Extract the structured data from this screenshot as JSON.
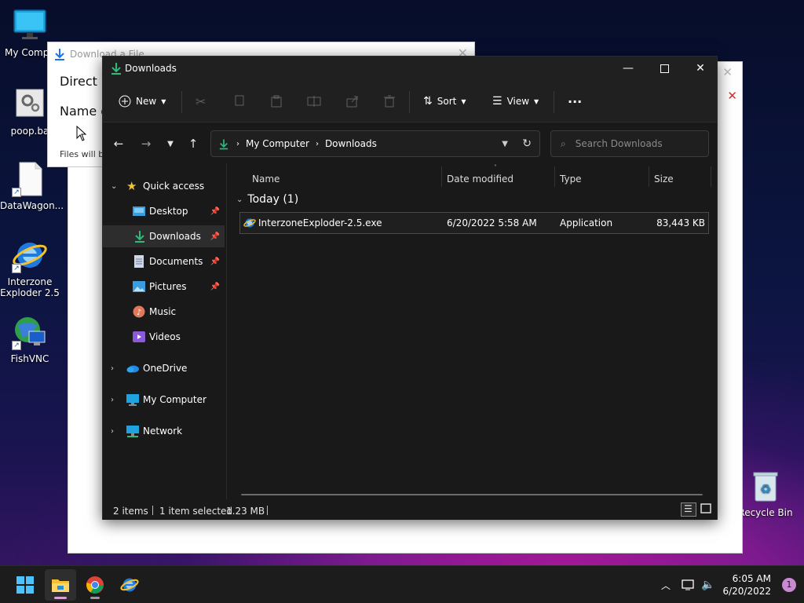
{
  "desktop": {
    "icons": [
      {
        "label": "My Compu",
        "icon": "monitor-icon"
      },
      {
        "label": "poop.ba",
        "icon": "settings-file-icon"
      },
      {
        "label": "DataWagon...",
        "icon": "blank-file-icon"
      },
      {
        "label": "Interzone Exploder 2.5",
        "line1": "Interzone",
        "line2": "Exploder 2.5",
        "icon": "ie-icon"
      },
      {
        "label": "FishVNC",
        "icon": "globe-network-icon"
      },
      {
        "label": "Recycle Bin",
        "icon": "recycle-bin-icon"
      }
    ]
  },
  "download_window": {
    "title": "Download a File",
    "line1": "Direct F",
    "line2": "Name o",
    "line3": "Files will be"
  },
  "explorer": {
    "title": "Downloads",
    "toolbar": {
      "new_label": "New",
      "sort_label": "Sort",
      "view_label": "View",
      "more_label": "···"
    },
    "address": {
      "segments": [
        "My Computer",
        "Downloads"
      ]
    },
    "search": {
      "placeholder": "Search Downloads"
    },
    "sidebar": {
      "quick_access": "Quick access",
      "items": [
        {
          "label": "Desktop",
          "pinned": true
        },
        {
          "label": "Downloads",
          "pinned": true
        },
        {
          "label": "Documents",
          "pinned": true
        },
        {
          "label": "Pictures",
          "pinned": true
        },
        {
          "label": "Music",
          "pinned": false
        },
        {
          "label": "Videos",
          "pinned": false
        }
      ],
      "onedrive": "OneDrive",
      "my_computer": "My Computer",
      "network": "Network"
    },
    "columns": {
      "name": "Name",
      "date": "Date modified",
      "type": "Type",
      "size": "Size"
    },
    "group": {
      "label": "Today (1)"
    },
    "files": [
      {
        "name": "InterzoneExploder-2.5.exe",
        "date": "6/20/2022 5:58 AM",
        "type": "Application",
        "size": "83,443 KB"
      }
    ],
    "status": {
      "items": "2 items",
      "selected": "1 item selected",
      "size": "1.23 MB"
    }
  },
  "taskbar": {
    "time": "6:05 AM",
    "date": "6/20/2022",
    "notifications": "1"
  },
  "colors": {
    "accent": "#0078d4",
    "folder_green": "#2dba7a",
    "dark_bg": "#191919"
  }
}
